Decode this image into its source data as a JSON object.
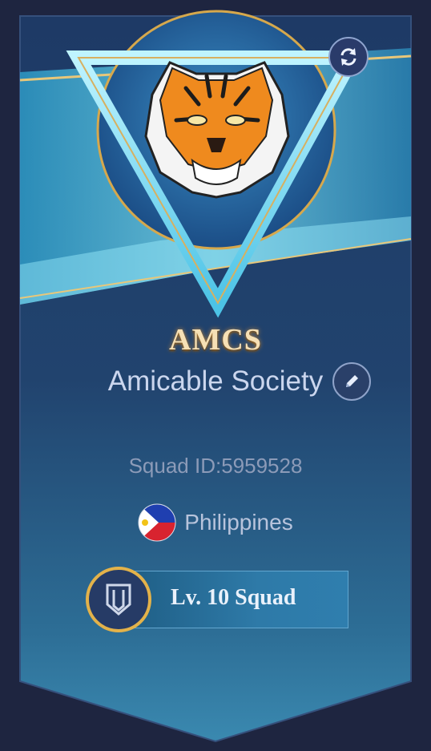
{
  "squad": {
    "tag": "AMCS",
    "name": "Amicable Society",
    "id_text": "Squad ID:5959528",
    "country": "Philippines",
    "level_label": "Lv. 10 Squad"
  },
  "icons": {
    "refresh": "refresh-icon",
    "edit": "pencil-icon",
    "flag": "philippines-flag-icon",
    "emblem": "tiger-emblem",
    "level": "shield-level-icon"
  },
  "colors": {
    "background": "#1e2540",
    "banner": "#1f3e6b",
    "accent_gold": "#e3b24a",
    "light_cyan": "#6fd8f0",
    "tag_text": "#f6e0b5"
  }
}
